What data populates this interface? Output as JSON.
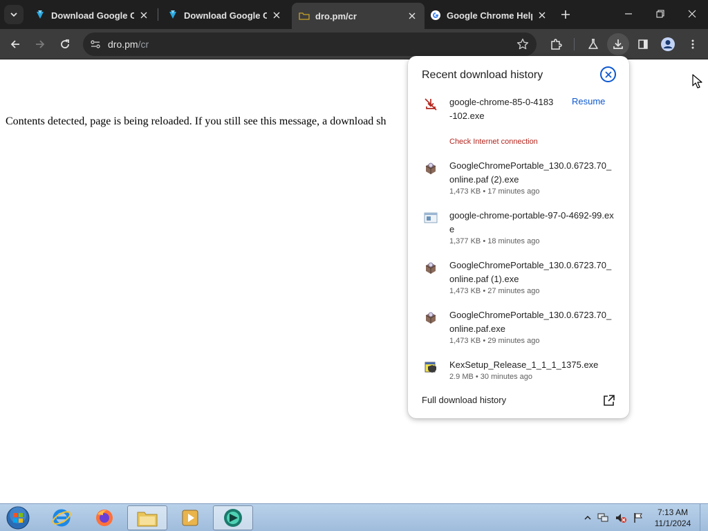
{
  "tabs": [
    {
      "title": "Download Google Chrome",
      "favicon": "download-arrow-icon",
      "active": false
    },
    {
      "title": "Download Google Chrome",
      "favicon": "download-arrow-icon",
      "active": false
    },
    {
      "title": "dro.pm/cr",
      "favicon": "loading-folder-icon",
      "active": true
    },
    {
      "title": "Google Chrome Help",
      "favicon": "google-g-icon",
      "active": false
    }
  ],
  "address_bar": {
    "host": "dro.pm",
    "path": "/cr"
  },
  "page": {
    "message": "Contents detected, page is being reloaded. If you still see this message, a download sh"
  },
  "download_bubble": {
    "title": "Recent download history",
    "items": [
      {
        "name": "google-chrome-85-0-4183-102.exe",
        "meta": "Check Internet connection",
        "status": "failed",
        "action": "Resume",
        "icon": "download-failed-icon"
      },
      {
        "name": "GoogleChromePortable_130.0.6723.70_online.paf (2).exe",
        "meta": "1,473 KB • 17 minutes ago",
        "icon": "installer-package-icon"
      },
      {
        "name": "google-chrome-portable-97-0-4692-99.exe",
        "meta": "1,377 KB • 18 minutes ago",
        "icon": "executable-window-icon"
      },
      {
        "name": "GoogleChromePortable_130.0.6723.70_online.paf (1).exe",
        "meta": "1,473 KB • 27 minutes ago",
        "icon": "installer-package-icon"
      },
      {
        "name": "GoogleChromePortable_130.0.6723.70_online.paf.exe",
        "meta": "1,473 KB • 29 minutes ago",
        "icon": "installer-package-icon"
      },
      {
        "name": "KexSetup_Release_1_1_1_1375.exe",
        "meta": "2.9 MB • 30 minutes ago",
        "icon": "setup-shield-icon"
      }
    ],
    "footer": "Full download history"
  },
  "taskbar": {
    "apps": [
      "internet-explorer-icon",
      "firefox-icon",
      "file-explorer-icon",
      "media-player-icon",
      "chrome-task-icon"
    ],
    "clock": {
      "time": "7:13 AM",
      "date": "11/1/2024"
    }
  },
  "colors": {
    "tab_strip": "#1f1f1f",
    "toolbar": "#3c3c3c",
    "accent": "#0b57d0",
    "error": "#b3261e"
  }
}
